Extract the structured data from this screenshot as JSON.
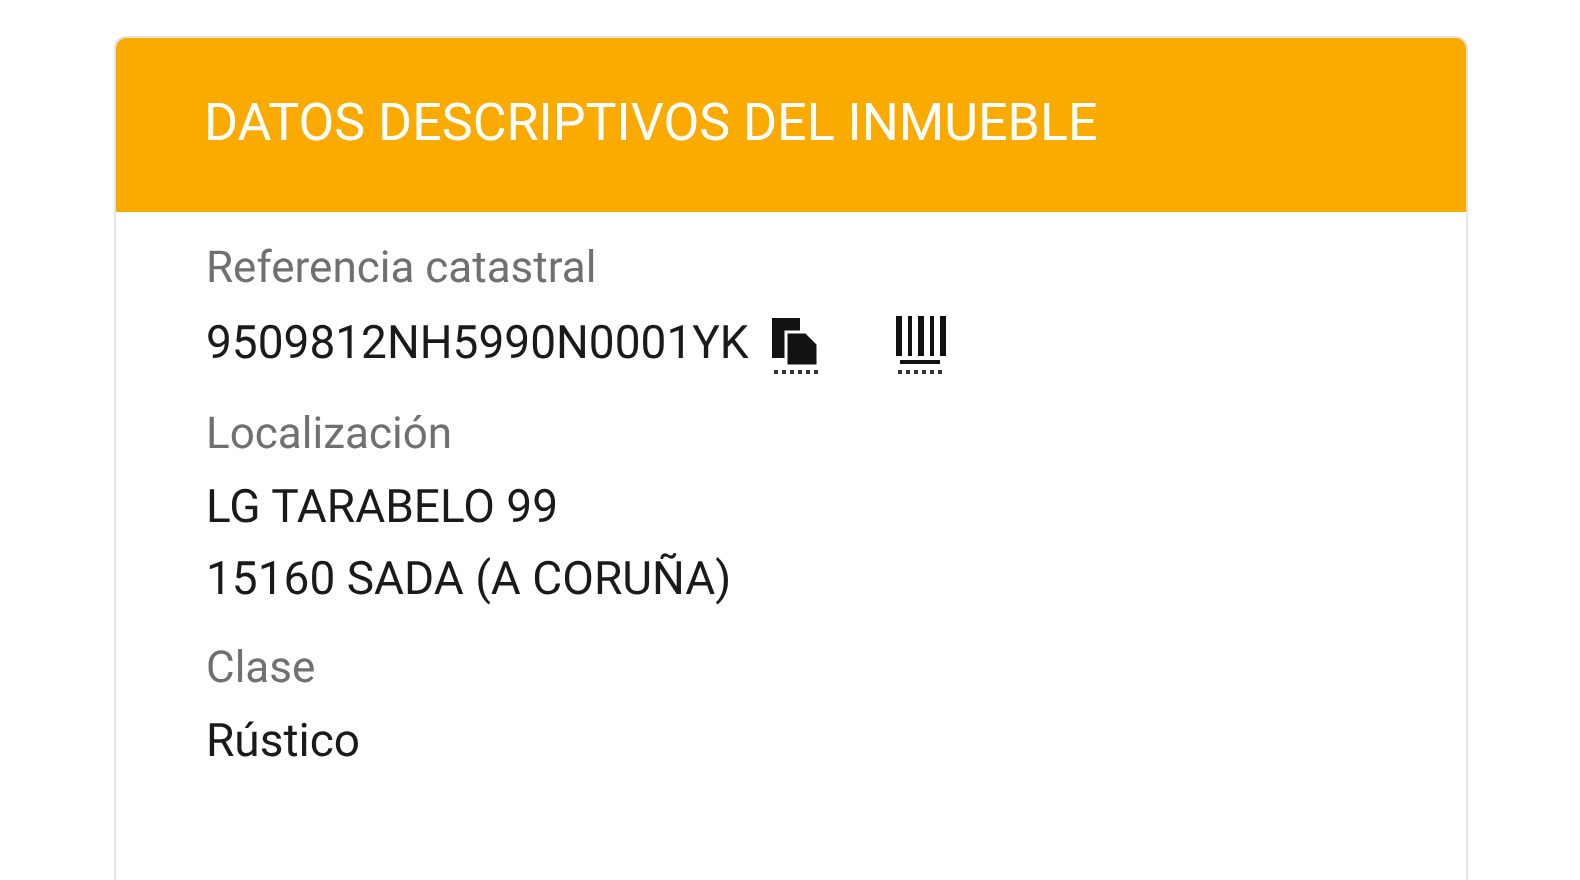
{
  "card": {
    "title": "DATOS DESCRIPTIVOS DEL INMUEBLE",
    "fields": [
      {
        "kind": "reference",
        "label": "Referencia catastral",
        "lines": [
          "9509812NH5990N0001YK"
        ]
      },
      {
        "kind": "text",
        "label": "Localización",
        "lines": [
          "LG TARABELO 99",
          "15160 SADA (A CORUÑA)"
        ]
      },
      {
        "kind": "text",
        "label": "Clase",
        "lines": [
          "Rústico"
        ]
      }
    ]
  }
}
